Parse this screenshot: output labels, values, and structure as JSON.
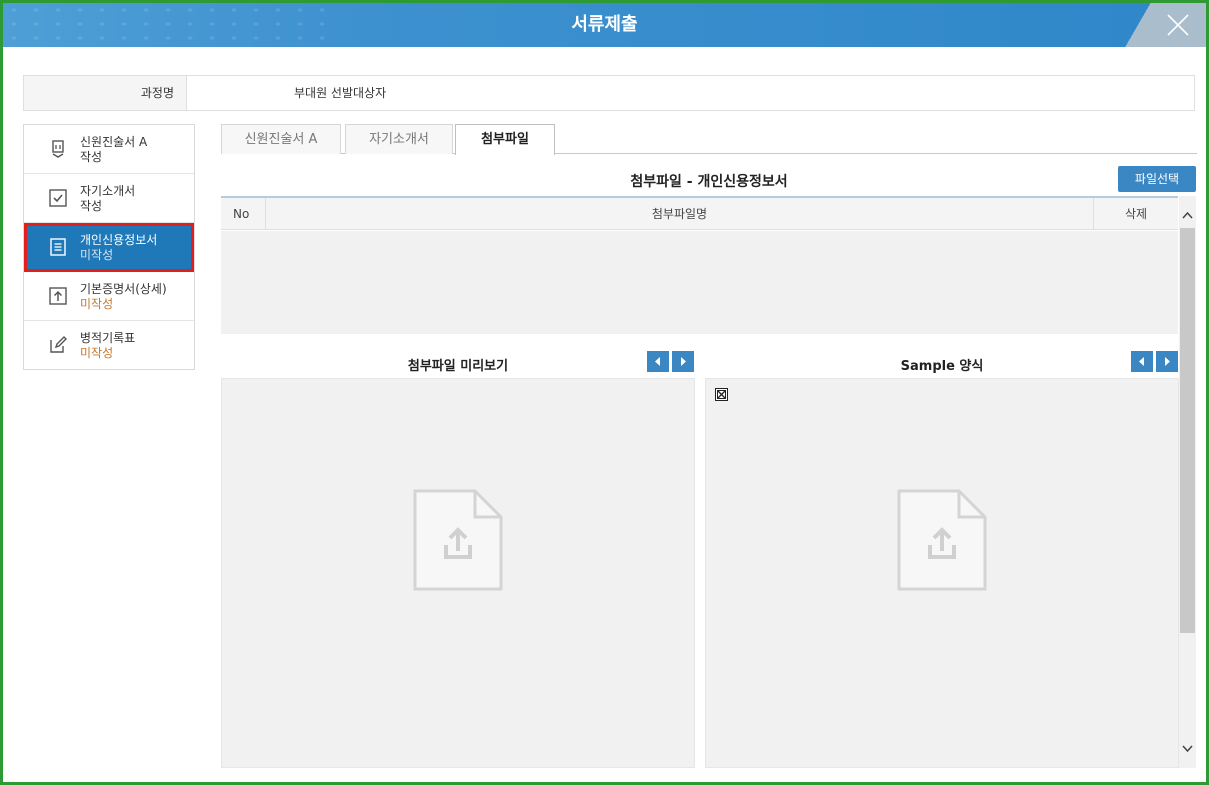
{
  "window": {
    "title": "서류제출"
  },
  "course": {
    "label": "과정명",
    "value": "부대원 선발대상자"
  },
  "sidebar": {
    "items": [
      {
        "name": "신원진술서 A",
        "status": "작성",
        "icon": "stamp-icon",
        "pending": false,
        "active": false
      },
      {
        "name": "자기소개서",
        "status": "작성",
        "icon": "checkbox-icon",
        "pending": false,
        "active": false
      },
      {
        "name": "개인신용정보서",
        "status": "미작성",
        "icon": "document-icon",
        "pending": true,
        "active": true
      },
      {
        "name": "기본증명서(상세)",
        "status": "미작성",
        "icon": "upload-box-icon",
        "pending": true,
        "active": false
      },
      {
        "name": "병적기록표",
        "status": "미작성",
        "icon": "edit-icon",
        "pending": true,
        "active": false
      }
    ]
  },
  "tabs": [
    {
      "label": "신원진술서 A",
      "active": false
    },
    {
      "label": "자기소개서",
      "active": false
    },
    {
      "label": "첨부파일",
      "active": true
    }
  ],
  "attachments": {
    "title": "첨부파일 - 개인신용정보서",
    "file_select_label": "파일선택",
    "columns": {
      "no": "No",
      "name": "첨부파일명",
      "delete": "삭제"
    },
    "rows": []
  },
  "preview": {
    "left_title": "첨부파일 미리보기",
    "right_title": "Sample 양식"
  },
  "colors": {
    "titlebar": "#3d91cf",
    "accent": "#3b87c4",
    "active_item": "#1f78b8",
    "highlight_border": "#e0201c",
    "pending_text": "#c8772b",
    "frame_border": "#2e9a34"
  }
}
